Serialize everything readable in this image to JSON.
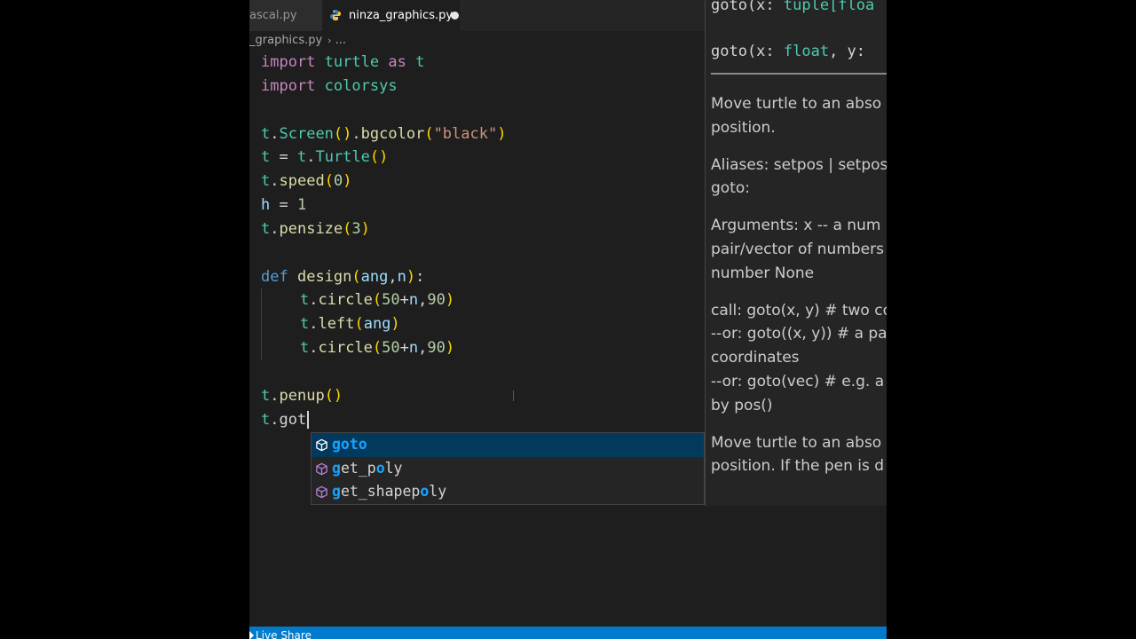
{
  "tabs": [
    {
      "label": "pascal.py",
      "display": "ascal.py",
      "active": false
    },
    {
      "label": "ninza_graphics.py",
      "active": true,
      "unsaved": true
    }
  ],
  "breadcrumb": {
    "file": "_graphics.py",
    "sep": "›",
    "rest": "..."
  },
  "code": {
    "l1": {
      "import": "import",
      "mod": "turtle",
      "as": "as",
      "alias": "t"
    },
    "l2": {
      "import": "import",
      "mod": "colorsys"
    },
    "l4": {
      "obj": "t",
      "dot1": ".",
      "cls": "Screen",
      "p1": "()",
      "dot2": ".",
      "fn": "bgcolor",
      "po": "(",
      "str": "\"black\"",
      "pc": ")"
    },
    "l5": {
      "var": "t",
      "eq": " = ",
      "obj": "t",
      "dot": ".",
      "cls": "Turtle",
      "p": "()"
    },
    "l6": {
      "obj": "t",
      "dot": ".",
      "fn": "speed",
      "po": "(",
      "num": "0",
      "pc": ")"
    },
    "l7": {
      "var": "h",
      "eq": " = ",
      "num": "1"
    },
    "l8": {
      "obj": "t",
      "dot": ".",
      "fn": "pensize",
      "po": "(",
      "num": "3",
      "pc": ")"
    },
    "l10": {
      "def": "def",
      "fn": "design",
      "po": "(",
      "a1": "ang",
      "comma": ",",
      "a2": "n",
      "pc": ")",
      "colon": ":"
    },
    "l11": {
      "obj": "t",
      "dot": ".",
      "fn": "circle",
      "po": "(",
      "n1": "50",
      "plus": "+",
      "v": "n",
      "comma": ",",
      "n2": "90",
      "pc": ")"
    },
    "l12": {
      "obj": "t",
      "dot": ".",
      "fn": "left",
      "po": "(",
      "a": "ang",
      "pc": ")"
    },
    "l13": {
      "obj": "t",
      "dot": ".",
      "fn": "circle",
      "po": "(",
      "n1": "50",
      "plus": "+",
      "v": "n",
      "comma": ",",
      "n2": "90",
      "pc": ")"
    },
    "l15": {
      "obj": "t",
      "dot": ".",
      "fn": "penup",
      "p": "()"
    },
    "l16": {
      "obj": "t",
      "dot": ".",
      "typed": "got"
    }
  },
  "suggestions": [
    {
      "label": "goto",
      "match": "goto",
      "rest": "",
      "selected": true
    },
    {
      "label": "get_poly",
      "pre": "g",
      "mid1": "et_p",
      "m2": "o",
      "post": "ly",
      "selected": false
    },
    {
      "label": "get_shapepoly",
      "pre": "g",
      "mid1": "et_shapep",
      "m2": "o",
      "post": "ly",
      "selected": false
    }
  ],
  "doc": {
    "sig1": {
      "a": "goto(x: ",
      "ty": "tuple[floa"
    },
    "sig2": {
      "a": "goto(x: ",
      "ty": "float",
      "b": ", y:"
    },
    "p1": "Move turtle to an abso\nposition.",
    "p2": "Aliases: setpos | setpos\ngoto:",
    "p3": "Arguments: x -- a num\npair/vector of numbers\nnumber None",
    "p4": "call: goto(x, y) # two co\n--or: goto((x, y)) # a pa\ncoordinates\n--or: goto(vec) # e.g. a\nby pos()",
    "p5": "Move turtle to an abso\nposition. If the pen is d"
  },
  "statusbar": {
    "live_share": "Live Share"
  },
  "colors": {
    "accent": "#007acc",
    "editor_bg": "#1e1e1e",
    "selection": "#04395e",
    "match": "#18a3ff"
  }
}
